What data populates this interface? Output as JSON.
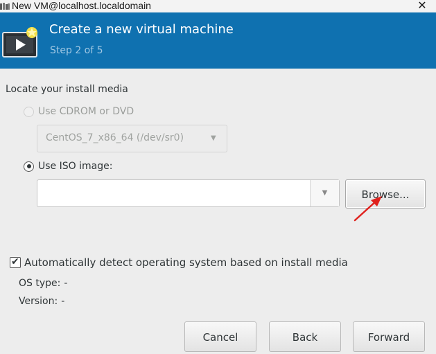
{
  "window": {
    "title": "New VM@localhost.localdomain",
    "close_glyph": "✕",
    "app_icon": "virt-manager-icon"
  },
  "banner": {
    "heading": "Create a new virtual machine",
    "step": "Step 2 of 5",
    "icon": "new-vm-icon",
    "background_color": "#0f71b0"
  },
  "install_media": {
    "section_label": "Locate your install media",
    "cdrom_option": {
      "label": "Use CDROM or DVD",
      "selected": false,
      "enabled": false
    },
    "cdrom_device": {
      "value": "CentOS_7_x86_64 (/dev/sr0)",
      "enabled": false
    },
    "iso_option": {
      "label": "Use ISO image:",
      "selected": true,
      "enabled": true
    },
    "iso_path": {
      "value": ""
    },
    "browse_label": "Browse..."
  },
  "os_detection": {
    "auto_detect_label": "Automatically detect operating system based on install media",
    "auto_detect_checked": true,
    "os_type_label": "OS type:",
    "os_type_value": "-",
    "version_label": "Version:",
    "version_value": "-"
  },
  "footer": {
    "cancel_label": "Cancel",
    "back_label": "Back",
    "forward_label": "Forward"
  },
  "annotation": {
    "arrow_color": "#e0211d"
  }
}
